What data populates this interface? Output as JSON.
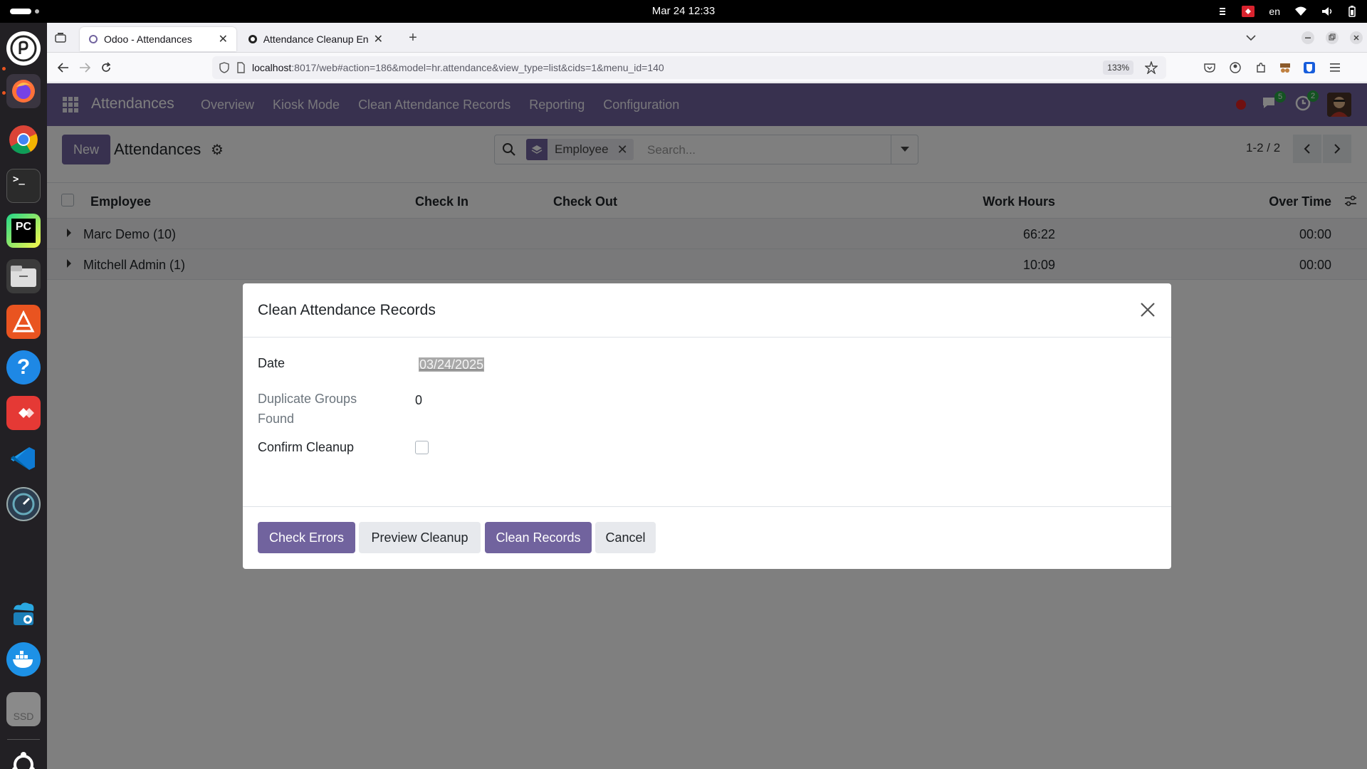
{
  "system": {
    "clock": "Mar 24  12:33",
    "language": "en"
  },
  "browser": {
    "tabs": [
      {
        "label": "Odoo - Attendances",
        "active": true
      },
      {
        "label": "Attendance Cleanup Enh",
        "active": false
      }
    ],
    "url_host": "localhost",
    "url_rest": ":8017/web#action=186&model=hr.attendance&view_type=list&cids=1&menu_id=140",
    "zoom": "133%"
  },
  "odoo": {
    "brand": "Attendances",
    "menu": [
      "Overview",
      "Kiosk Mode",
      "Clean Attendance Records",
      "Reporting",
      "Configuration"
    ],
    "messages_count": "5",
    "activities_count": "2",
    "new_label": "New",
    "breadcrumb": "Attendances",
    "search": {
      "facet_label": "Employee",
      "placeholder": "Search..."
    },
    "pager": "1-2 / 2",
    "list": {
      "columns": [
        "Employee",
        "Check In",
        "Check Out",
        "Work Hours",
        "Over Time"
      ],
      "groups": [
        {
          "name": "Marc Demo (10)",
          "work_hours": "66:22",
          "over_time": "00:00"
        },
        {
          "name": "Mitchell Admin (1)",
          "work_hours": "10:09",
          "over_time": "00:00"
        }
      ]
    }
  },
  "dialog": {
    "title": "Clean Attendance Records",
    "date_label": "Date",
    "date_value": "03/24/2025",
    "dup_label_line1": "Duplicate Groups",
    "dup_label_line2": "Found",
    "dup_value": "0",
    "confirm_label": "Confirm Cleanup",
    "confirm_checked": false,
    "buttons": {
      "check_errors": "Check Errors",
      "preview": "Preview Cleanup",
      "clean": "Clean Records",
      "cancel": "Cancel"
    }
  },
  "colors": {
    "odoo_primary": "#71639e",
    "badge_green": "#28a745"
  }
}
